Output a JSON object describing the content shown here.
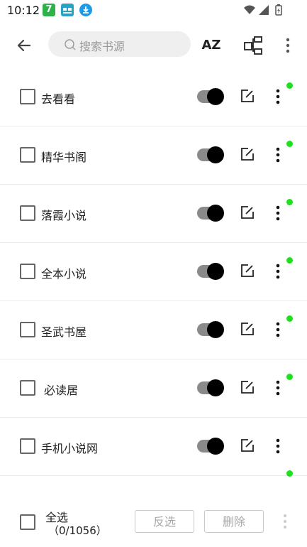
{
  "status_bar": {
    "time": "10:12",
    "app_icon_1_label": "7"
  },
  "toolbar": {
    "search_placeholder": "搜索书源",
    "sort_label": "AZ"
  },
  "sources": [
    {
      "name": "去看看",
      "enabled": true
    },
    {
      "name": "精华书阁",
      "enabled": true
    },
    {
      "name": "落霞小说",
      "enabled": true
    },
    {
      "name": "全本小说",
      "enabled": true
    },
    {
      "name": "圣武书屋",
      "enabled": true
    },
    {
      "name": "必读居",
      "enabled": true
    },
    {
      "name": "手机小说网",
      "enabled": true
    },
    {
      "name": "",
      "enabled": true
    }
  ],
  "bottom_bar": {
    "select_all_label": "全选",
    "count_label": "（0/1056）",
    "reverse_label": "反选",
    "delete_label": "删除"
  },
  "colors": {
    "status_dot": "#1fe01f",
    "switch_track": "#8a8a8a",
    "switch_knob": "#000000",
    "search_bg": "#efefef"
  }
}
